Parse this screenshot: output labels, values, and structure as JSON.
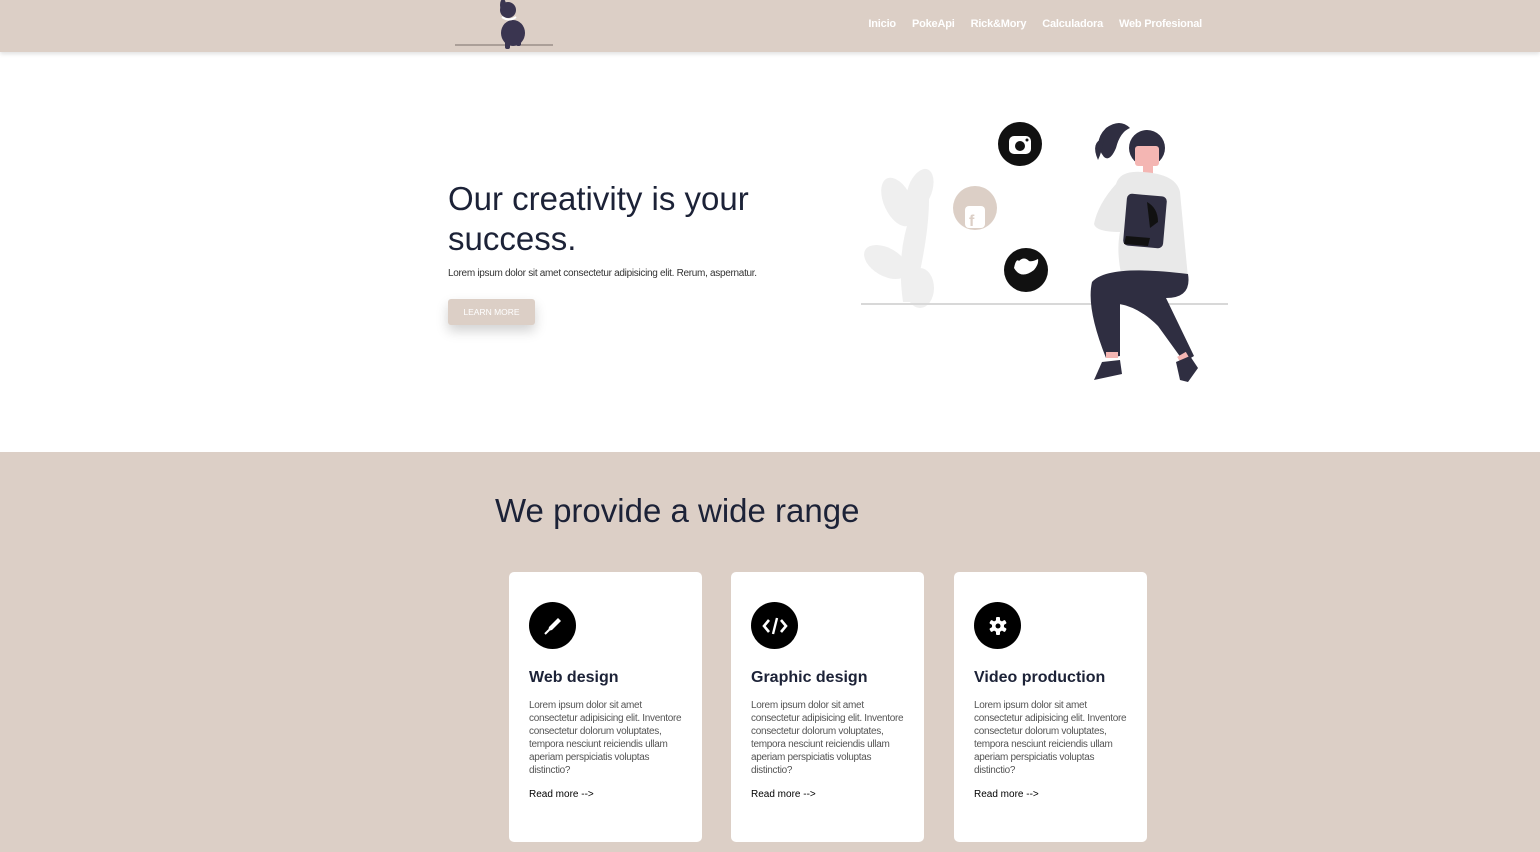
{
  "nav": {
    "links": [
      "Inicio",
      "PokeApi",
      "Rick&Mory",
      "Calculadora",
      "Web Profesional"
    ]
  },
  "hero": {
    "title": "Our creativity is your success.",
    "subtitle": "Lorem ipsum dolor sit amet consectetur adipisicing elit. Rerum, aspernatur.",
    "button": "LEARN MORE"
  },
  "services": {
    "title": "We provide a wide range",
    "cards": [
      {
        "icon": "pen-nib-icon",
        "title": "Web design",
        "text": "Lorem ipsum dolor sit amet consectetur adipisicing elit. Inventore consectetur dolorum voluptates, tempora nesciunt reiciendis ullam aperiam perspiciatis voluptas distinctio?",
        "link": "Read more -->"
      },
      {
        "icon": "code-icon",
        "title": "Graphic design",
        "text": "Lorem ipsum dolor sit amet consectetur adipisicing elit. Inventore consectetur dolorum voluptates, tempora nesciunt reiciendis ullam aperiam perspiciatis voluptas distinctio?",
        "link": "Read more -->"
      },
      {
        "icon": "gear-icon",
        "title": "Video production",
        "text": "Lorem ipsum dolor sit amet consectetur adipisicing elit. Inventore consectetur dolorum voluptates, tempora nesciunt reiciendis ullam aperiam perspiciatis voluptas distinctio?",
        "link": "Read more -->"
      }
    ]
  },
  "colors": {
    "accent": "#dccfc6",
    "dark": "#1c2237"
  }
}
